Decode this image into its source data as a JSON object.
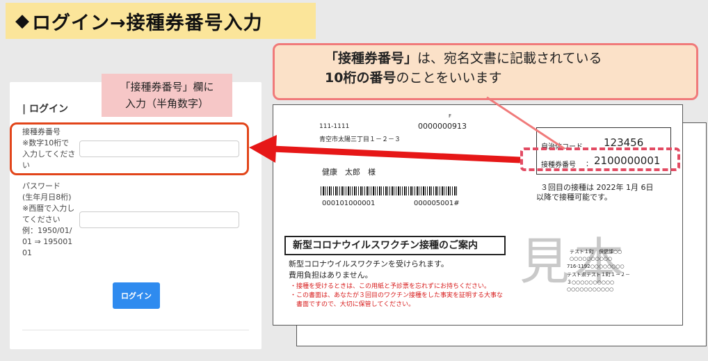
{
  "title": {
    "diamond": "◆",
    "text": "ログイン→接種券番号入力"
  },
  "login": {
    "heading": "| ログイン",
    "ticket_label_lines": [
      "接種券番号",
      "※数字10桁で",
      "入力してくださ",
      "い"
    ],
    "ticket_value": "",
    "password_label_lines": [
      "パスワード",
      "(生年月日8桁)",
      "※西暦で入力し",
      "てください",
      "例：1950/01/",
      "01 ⇒ 195001",
      "01"
    ],
    "password_value": "",
    "button_label": "ログイン"
  },
  "pink_callout": {
    "line1": "「接種券番号」欄に",
    "line2": "入力（半角数字）"
  },
  "explain_callout": {
    "line1_bold": "「接種券番号」",
    "line1_rest": "は、宛名文書に記載されている",
    "line2_bold": "10桁の番号",
    "line2_rest": "のことをいいます"
  },
  "document": {
    "postal": "111-1111",
    "number_top": "0000000913",
    "mark_f": "F",
    "address": "青空市太陽三丁目１－２－３",
    "name": "健康　太郎　様",
    "barcode_num_left": "000101000001",
    "barcode_num_right": "000005001#",
    "municipal_label": "自治体コード",
    "municipal_code": "123456",
    "ticket_label": "接種券番号",
    "ticket_colon": "：",
    "ticket_number": "2100000001",
    "vaccination_line1": "３回目の接種は 2022年 1月 6日",
    "vaccination_line2": "以降で接種可能です。",
    "notice_title": "新型コロナウイルスワクチン接種のご案内",
    "body_line1": "新型コロナウイルスワクチンを受けられます。",
    "body_line2": "費用負担はありません。",
    "red_line1": "・接種を受けるときは、この用紙と予診票を忘れずにお持ちください。",
    "red_line2": "・この書面は、あなたが３回目のワクチン接種をした事実を証明する大事な",
    "red_line3": "　書面ですので、大切に保管してください。",
    "sender_line1": "テスト１町　保健課○○",
    "sender_line2": "○○○○○○○○○○",
    "sender_line3": "716-1192○○○○○○○○",
    "sender_line4": "テスト県テスト１町１－２－",
    "sender_line5": "３○○○○○○○○○○",
    "sender_line6": "○○○○○○○○○○○",
    "watermark": "見本"
  },
  "colors": {
    "banner": "#fbe59a",
    "highlight": "#e2451a",
    "button": "#2f8bef",
    "callout_border": "#f07a7a"
  }
}
